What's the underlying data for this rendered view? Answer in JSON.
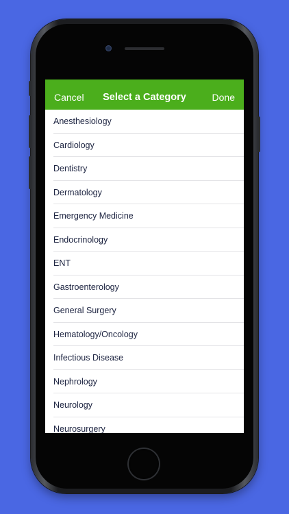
{
  "navbar": {
    "cancel_label": "Cancel",
    "title": "Select a Category",
    "done_label": "Done",
    "background_color": "#4bae1c"
  },
  "categories": [
    {
      "label": "Anesthesiology"
    },
    {
      "label": "Cardiology"
    },
    {
      "label": "Dentistry"
    },
    {
      "label": "Dermatology"
    },
    {
      "label": "Emergency Medicine"
    },
    {
      "label": "Endocrinology"
    },
    {
      "label": "ENT"
    },
    {
      "label": "Gastroenterology"
    },
    {
      "label": "General Surgery"
    },
    {
      "label": "Hematology/Oncology"
    },
    {
      "label": "Infectious Disease"
    },
    {
      "label": "Nephrology"
    },
    {
      "label": "Neurology"
    },
    {
      "label": "Neurosurgery"
    }
  ],
  "colors": {
    "page_background": "#4a67e3",
    "text": "#1c2340"
  }
}
